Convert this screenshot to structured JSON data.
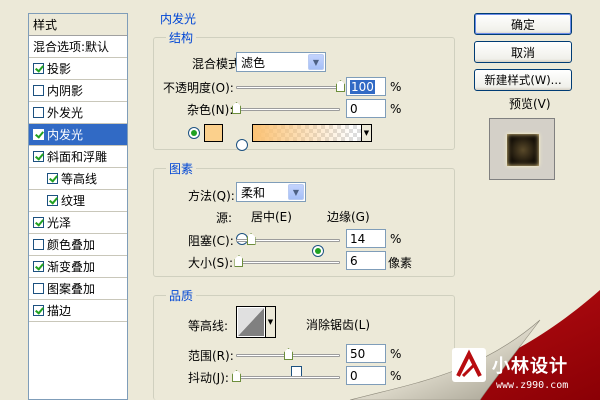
{
  "style_list": {
    "header": "样式",
    "items": [
      {
        "label": "混合选项:默认",
        "checkbox": false,
        "checked": false,
        "indent": false,
        "selected": false
      },
      {
        "label": "投影",
        "checkbox": true,
        "checked": true,
        "indent": false,
        "selected": false
      },
      {
        "label": "内阴影",
        "checkbox": true,
        "checked": false,
        "indent": false,
        "selected": false
      },
      {
        "label": "外发光",
        "checkbox": true,
        "checked": false,
        "indent": false,
        "selected": false
      },
      {
        "label": "内发光",
        "checkbox": true,
        "checked": true,
        "indent": false,
        "selected": true
      },
      {
        "label": "斜面和浮雕",
        "checkbox": true,
        "checked": true,
        "indent": false,
        "selected": false
      },
      {
        "label": "等高线",
        "checkbox": true,
        "checked": true,
        "indent": true,
        "selected": false
      },
      {
        "label": "纹理",
        "checkbox": true,
        "checked": true,
        "indent": true,
        "selected": false
      },
      {
        "label": "光泽",
        "checkbox": true,
        "checked": true,
        "indent": false,
        "selected": false
      },
      {
        "label": "颜色叠加",
        "checkbox": true,
        "checked": false,
        "indent": false,
        "selected": false
      },
      {
        "label": "渐变叠加",
        "checkbox": true,
        "checked": true,
        "indent": false,
        "selected": false
      },
      {
        "label": "图案叠加",
        "checkbox": true,
        "checked": false,
        "indent": false,
        "selected": false
      },
      {
        "label": "描边",
        "checkbox": true,
        "checked": true,
        "indent": false,
        "selected": false
      }
    ]
  },
  "panel_title": "内发光",
  "structure": {
    "title": "结构",
    "blend_mode_label": "混合模式:",
    "blend_mode_value": "滤色",
    "opacity_label": "不透明度(O):",
    "opacity_value": "100",
    "opacity_unit": "%",
    "opacity_level": 1.0,
    "noise_label": "杂色(N):",
    "noise_value": "0",
    "noise_unit": "%",
    "noise_level": 0.0,
    "color_swatch": "#fbd08c",
    "gradient_start": "#fbc274"
  },
  "elements": {
    "title": "图素",
    "method_label": "方法(Q):",
    "method_value": "柔和",
    "source_label": "源:",
    "source_center": "居中(E)",
    "source_edge": "边缘(G)",
    "choke_label": "阻塞(C):",
    "choke_value": "14",
    "choke_unit": "%",
    "choke_level": 0.14,
    "size_label": "大小(S):",
    "size_value": "6",
    "size_unit": "像素",
    "size_level": 0.024
  },
  "quality": {
    "title": "品质",
    "contour_label": "等高线:",
    "anti_alias_label": "消除锯齿(L)",
    "range_label": "范围(R):",
    "range_value": "50",
    "range_unit": "%",
    "range_level": 0.5,
    "jitter_label": "抖动(J):",
    "jitter_value": "0",
    "jitter_unit": "%",
    "jitter_level": 0.0
  },
  "buttons": {
    "ok": "确定",
    "cancel": "取消",
    "new_style": "新建样式(W)...",
    "preview_label": "预览(V)"
  },
  "watermark": {
    "brand": "小林设计",
    "url": "www.z990.com"
  }
}
